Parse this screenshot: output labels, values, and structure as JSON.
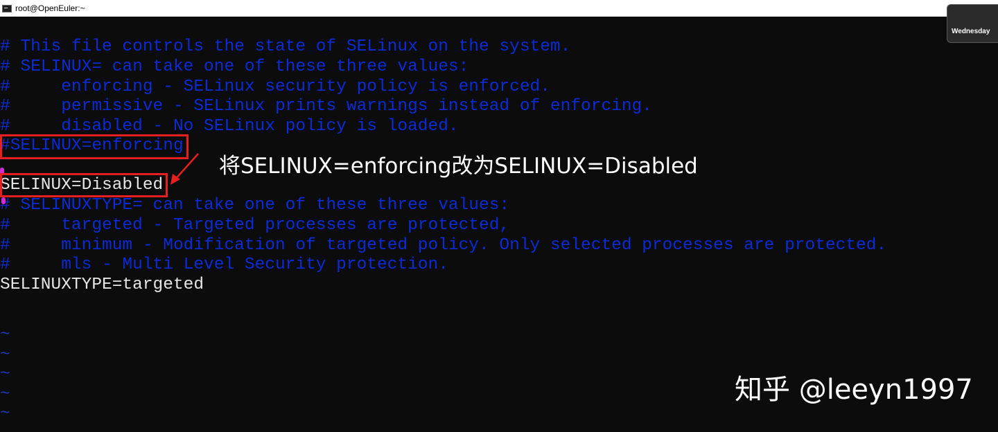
{
  "window": {
    "title": "root@OpenEuler:~",
    "icon": "terminal-icon"
  },
  "taskbar_tooltip": {
    "label": "Wednesday"
  },
  "editor": {
    "lines": [
      "# This file controls the state of SELinux on the system.",
      "# SELINUX= can take one of these three values:",
      "#     enforcing - SELinux security policy is enforced.",
      "#     permissive - SELinux prints warnings instead of enforcing.",
      "#     disabled - No SELinux policy is loaded.",
      "#SELINUX=enforcing",
      "",
      "SELINUX=Disabled",
      "# SELINUXTYPE= can take one of these three values:",
      "#     targeted - Targeted processes are protected,",
      "#     minimum - Modification of targeted policy. Only selected processes are protected.",
      "#     mls - Multi Level Security protection.",
      "SELINUXTYPE=targeted"
    ],
    "empty_line_markers": [
      "~",
      "~",
      "~",
      "~",
      "~"
    ]
  },
  "annotation": {
    "text": "将SELINUX=enforcing改为SELINUX=Disabled"
  },
  "watermark": {
    "text": "知乎 @leeyn1997"
  },
  "colors": {
    "terminal_bg": "#0c0c0c",
    "comment_text": "#0c2bd6",
    "setting_text": "#e6e6e6",
    "highlight_box": "#e81f1f",
    "annotation_text": "#ffffff"
  }
}
